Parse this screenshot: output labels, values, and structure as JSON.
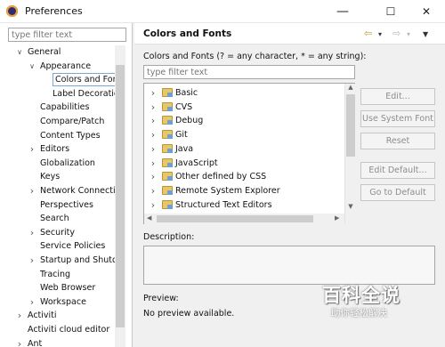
{
  "window": {
    "title": "Preferences",
    "minimize": "—",
    "maximize": "☐",
    "close": "✕"
  },
  "sidebar": {
    "filter_placeholder": "type filter text",
    "items": [
      {
        "label": "General",
        "twisty": "expanded"
      },
      {
        "label": "Appearance",
        "twisty": "expanded"
      },
      {
        "label": "Colors and Fonts",
        "twisty": "",
        "selected": true
      },
      {
        "label": "Label Decorations",
        "twisty": ""
      },
      {
        "label": "Capabilities",
        "twisty": ""
      },
      {
        "label": "Compare/Patch",
        "twisty": ""
      },
      {
        "label": "Content Types",
        "twisty": ""
      },
      {
        "label": "Editors",
        "twisty": "collapsed"
      },
      {
        "label": "Globalization",
        "twisty": ""
      },
      {
        "label": "Keys",
        "twisty": ""
      },
      {
        "label": "Network Connections",
        "twisty": "collapsed"
      },
      {
        "label": "Perspectives",
        "twisty": ""
      },
      {
        "label": "Search",
        "twisty": ""
      },
      {
        "label": "Security",
        "twisty": "collapsed"
      },
      {
        "label": "Service Policies",
        "twisty": ""
      },
      {
        "label": "Startup and Shutdown",
        "twisty": "collapsed"
      },
      {
        "label": "Tracing",
        "twisty": ""
      },
      {
        "label": "Web Browser",
        "twisty": ""
      },
      {
        "label": "Workspace",
        "twisty": "collapsed"
      },
      {
        "label": "Activiti",
        "twisty": "collapsed"
      },
      {
        "label": "Activiti cloud editor",
        "twisty": ""
      },
      {
        "label": "Ant",
        "twisty": "collapsed"
      }
    ]
  },
  "page": {
    "title": "Colors and Fonts",
    "nav_back": "⇦",
    "nav_forward": "⇨",
    "nav_dropdown": "▾",
    "menu": "▼",
    "instruction": "Colors and Fonts (? = any character, * = any string):",
    "filter_placeholder": "type filter text",
    "categories": [
      {
        "label": "Basic"
      },
      {
        "label": "CVS"
      },
      {
        "label": "Debug"
      },
      {
        "label": "Git"
      },
      {
        "label": "Java"
      },
      {
        "label": "JavaScript"
      },
      {
        "label": "Other defined by CSS"
      },
      {
        "label": "Remote System Explorer"
      },
      {
        "label": "Structured Text Editors"
      }
    ],
    "buttons": {
      "edit": "Edit...",
      "use_system_font": "Use System Font",
      "reset": "Reset",
      "edit_default": "Edit Default...",
      "go_to_default": "Go to Default"
    },
    "description_label": "Description:",
    "preview_label": "Preview:",
    "preview_text": "No preview available."
  },
  "watermark": {
    "big": "百科全说",
    "small": "助你轻松解决"
  }
}
